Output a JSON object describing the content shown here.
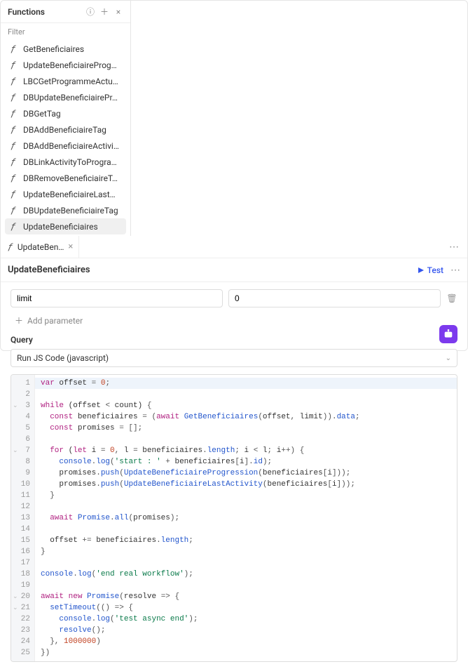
{
  "sidebar": {
    "title": "Functions",
    "filter_label": "Filter",
    "items": [
      {
        "label": "GetBeneficiaires",
        "selected": false
      },
      {
        "label": "UpdateBeneficiaireProg…",
        "selected": false
      },
      {
        "label": "LBCGetProgrammeActu…",
        "selected": false
      },
      {
        "label": "DBUpdateBeneficiairePr…",
        "selected": false
      },
      {
        "label": "DBGetTag",
        "selected": false
      },
      {
        "label": "DBAddBeneficiaireTag",
        "selected": false
      },
      {
        "label": "DBAddBeneficiaireActivi…",
        "selected": false
      },
      {
        "label": "DBLinkActivityToProgra…",
        "selected": false
      },
      {
        "label": "DBRemoveBeneficiaireT…",
        "selected": false
      },
      {
        "label": "UpdateBeneficiaireLast…",
        "selected": false
      },
      {
        "label": "DBUpdateBeneficiaireTag",
        "selected": false
      },
      {
        "label": "UpdateBeneficiaires",
        "selected": true
      }
    ]
  },
  "tab": {
    "label": "UpdateBen…"
  },
  "header": {
    "title": "UpdateBeneficiaires",
    "test_label": "Test"
  },
  "params": {
    "name_value": "limit",
    "value_value": "0",
    "add_label": "Add parameter"
  },
  "query": {
    "label": "Query",
    "runner": "Run JS Code (javascript)"
  },
  "code": {
    "fold_lines": [
      3,
      7,
      20,
      21
    ],
    "highlight_line": 1,
    "lines": [
      [
        [
          "kw",
          "var"
        ],
        [
          "",
          " offset "
        ],
        [
          "punc",
          "= "
        ],
        [
          "num",
          "0"
        ],
        [
          "punc",
          ";"
        ]
      ],
      [],
      [
        [
          "kw",
          "while"
        ],
        [
          "",
          " (offset "
        ],
        [
          "punc",
          "<"
        ],
        [
          "",
          " count) "
        ],
        [
          "punc",
          "{"
        ]
      ],
      [
        [
          "",
          "  "
        ],
        [
          "kw",
          "const"
        ],
        [
          "",
          " beneficiaires "
        ],
        [
          "punc",
          "= ("
        ],
        [
          "kw",
          "await"
        ],
        [
          "",
          " "
        ],
        [
          "id-blue",
          "GetBeneficiaires"
        ],
        [
          "punc",
          "("
        ],
        [
          "",
          "offset"
        ],
        [
          "punc",
          ", "
        ],
        [
          "",
          "limit"
        ],
        [
          "punc",
          "))."
        ],
        [
          "id-blue",
          "data"
        ],
        [
          "punc",
          ";"
        ]
      ],
      [
        [
          "",
          "  "
        ],
        [
          "kw",
          "const"
        ],
        [
          "",
          " promises "
        ],
        [
          "punc",
          "= [];"
        ]
      ],
      [],
      [
        [
          "",
          "  "
        ],
        [
          "kw",
          "for"
        ],
        [
          "",
          " ("
        ],
        [
          "kw",
          "let"
        ],
        [
          "",
          " i "
        ],
        [
          "punc",
          "= "
        ],
        [
          "num",
          "0"
        ],
        [
          "punc",
          ", "
        ],
        [
          "",
          "l "
        ],
        [
          "punc",
          "= "
        ],
        [
          "",
          "beneficiaires"
        ],
        [
          "punc",
          "."
        ],
        [
          "id-blue",
          "length"
        ],
        [
          "punc",
          "; "
        ],
        [
          "",
          "i "
        ],
        [
          "punc",
          "< "
        ],
        [
          "",
          "l"
        ],
        [
          "punc",
          "; "
        ],
        [
          "",
          "i"
        ],
        [
          "punc",
          "++"
        ],
        [
          "punc",
          ") {"
        ]
      ],
      [
        [
          "",
          "    "
        ],
        [
          "id-blue",
          "console"
        ],
        [
          "punc",
          "."
        ],
        [
          "id-blue",
          "log"
        ],
        [
          "punc",
          "("
        ],
        [
          "str",
          "'start : '"
        ],
        [
          "",
          " "
        ],
        [
          "punc",
          "+ "
        ],
        [
          "",
          "beneficiaires"
        ],
        [
          "punc",
          "["
        ],
        [
          "",
          "i"
        ],
        [
          "punc",
          "]."
        ],
        [
          "id-blue",
          "id"
        ],
        [
          "punc",
          ");"
        ]
      ],
      [
        [
          "",
          "    "
        ],
        [
          "",
          "promises"
        ],
        [
          "punc",
          "."
        ],
        [
          "id-blue",
          "push"
        ],
        [
          "punc",
          "("
        ],
        [
          "id-blue",
          "UpdateBeneficiaireProgression"
        ],
        [
          "punc",
          "("
        ],
        [
          "",
          "beneficiaires"
        ],
        [
          "punc",
          "["
        ],
        [
          "",
          "i"
        ],
        [
          "punc",
          "]));"
        ]
      ],
      [
        [
          "",
          "    "
        ],
        [
          "",
          "promises"
        ],
        [
          "punc",
          "."
        ],
        [
          "id-blue",
          "push"
        ],
        [
          "punc",
          "("
        ],
        [
          "id-blue",
          "UpdateBeneficiaireLastActivity"
        ],
        [
          "punc",
          "("
        ],
        [
          "",
          "beneficiaires"
        ],
        [
          "punc",
          "["
        ],
        [
          "",
          "i"
        ],
        [
          "punc",
          "]));"
        ]
      ],
      [
        [
          "",
          "  "
        ],
        [
          "punc",
          "}"
        ]
      ],
      [],
      [
        [
          "",
          "  "
        ],
        [
          "kw",
          "await"
        ],
        [
          "",
          " "
        ],
        [
          "id-blue",
          "Promise"
        ],
        [
          "punc",
          "."
        ],
        [
          "id-blue",
          "all"
        ],
        [
          "punc",
          "("
        ],
        [
          "",
          "promises"
        ],
        [
          "punc",
          ");"
        ]
      ],
      [],
      [
        [
          "",
          "  offset "
        ],
        [
          "punc",
          "+= "
        ],
        [
          "",
          "beneficiaires"
        ],
        [
          "punc",
          "."
        ],
        [
          "id-blue",
          "length"
        ],
        [
          "punc",
          ";"
        ]
      ],
      [
        [
          "punc",
          "}"
        ]
      ],
      [],
      [
        [
          "id-blue",
          "console"
        ],
        [
          "punc",
          "."
        ],
        [
          "id-blue",
          "log"
        ],
        [
          "punc",
          "("
        ],
        [
          "str",
          "'end real workflow'"
        ],
        [
          "punc",
          ");"
        ]
      ],
      [],
      [
        [
          "kw",
          "await"
        ],
        [
          "",
          " "
        ],
        [
          "kw",
          "new"
        ],
        [
          "",
          " "
        ],
        [
          "id-blue",
          "Promise"
        ],
        [
          "punc",
          "("
        ],
        [
          "",
          "resolve "
        ],
        [
          "punc",
          "=> {"
        ]
      ],
      [
        [
          "",
          "  "
        ],
        [
          "id-blue",
          "setTimeout"
        ],
        [
          "punc",
          "(() "
        ],
        [
          "punc",
          "=> {"
        ]
      ],
      [
        [
          "",
          "    "
        ],
        [
          "id-blue",
          "console"
        ],
        [
          "punc",
          "."
        ],
        [
          "id-blue",
          "log"
        ],
        [
          "punc",
          "("
        ],
        [
          "str",
          "'test async end'"
        ],
        [
          "punc",
          ");"
        ]
      ],
      [
        [
          "",
          "    "
        ],
        [
          "id-blue",
          "resolve"
        ],
        [
          "punc",
          "();"
        ]
      ],
      [
        [
          "",
          "  "
        ],
        [
          "punc",
          "}, "
        ],
        [
          "num",
          "1000000"
        ],
        [
          "punc",
          ")"
        ]
      ],
      [
        [
          "punc",
          "})"
        ]
      ]
    ]
  }
}
